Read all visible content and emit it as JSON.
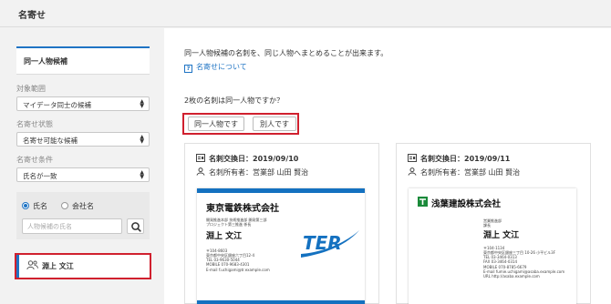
{
  "header": {
    "title": "名寄せ"
  },
  "sidebar": {
    "tab_label": "同一人物候補",
    "range": {
      "label": "対象範囲",
      "value": "マイデータ同士の候補"
    },
    "status": {
      "label": "名寄せ状態",
      "value": "名寄せ可能な候補"
    },
    "condition": {
      "label": "名寄せ条件",
      "value": "氏名が一致"
    },
    "search": {
      "radio_name": "氏名",
      "radio_company": "会社名",
      "placeholder": "人物候補の氏名"
    },
    "selected_person": "淵上 文江"
  },
  "main": {
    "description": "同一人物候補の名刺を、同じ人物へまとめることが出来ます。",
    "help_link": "名寄せについて",
    "question": "2枚の名刺は同一人物ですか？",
    "same_button": "同一人物です",
    "different_button": "別人です",
    "cards": [
      {
        "exchange_date": "名刺交換日：2019/09/10",
        "owner": "名刺所有者：営業部 山田 賢治",
        "company": "東京電鉄株式会社",
        "dept_line1": "開発推進本部 技術推進部 開発第三部",
        "dept_line2": "プロジェクト第三推進 係長",
        "name": "淵上 文江",
        "addr1": "〒104-8603",
        "addr2": "東京都中央区銀座六丁目12-4",
        "tel": "TEL 03-9630-5044",
        "mobile": "MOBILE 070-9683-4301",
        "email": "E-mail f.uchigami@tr.example.com",
        "logo_text": "TER"
      },
      {
        "exchange_date": "名刺交換日：2019/09/11",
        "owner": "名刺所有者：営業部 山田 賢治",
        "company": "浅葉建設株式会社",
        "dept_line1": "営業推進部",
        "dept_line2": "課長",
        "name": "淵上 文江",
        "addr1": "〒104-1134",
        "addr2": "東京都中央区銀座三丁目 10-26 小平ビル3F",
        "tel": "TEL 03-3464-0313",
        "fax": "FAX 03-3464-0314",
        "mobile": "MOBILE 070-8785-6679",
        "email": "E-mail fumie.uchigami@asaba.example.com",
        "url": "URL http://asaba.example.com"
      }
    ]
  },
  "colors": {
    "accent": "#1f74c4",
    "highlight": "#d0202e",
    "card_blue": "#1471c0",
    "logo_green": "#1a8a3a"
  }
}
